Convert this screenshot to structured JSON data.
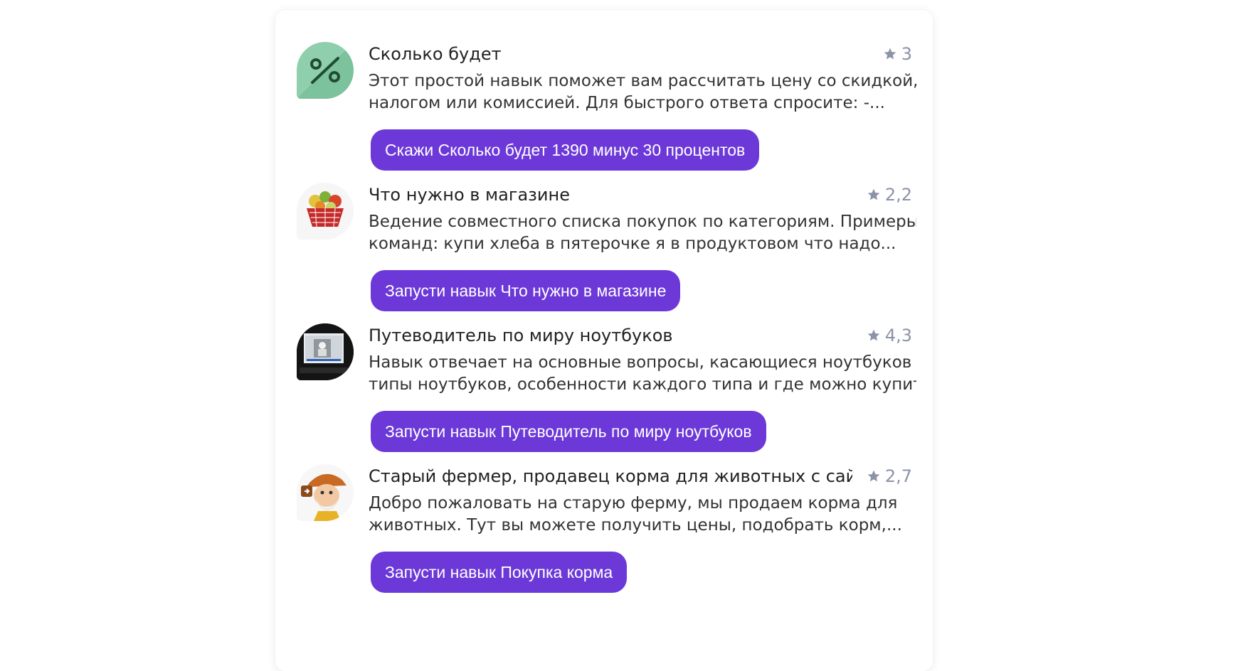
{
  "skills": [
    {
      "title": "Сколько будет",
      "rating": "3",
      "desc_line1": "Этот простой навык поможет вам рассчитать цену со скидкой,",
      "desc_line2": "налогом или комиссией. Для быстрого ответа спросите: -...",
      "button": "Скажи Сколько будет 1390 минус 30 процентов",
      "icon": "percent-icon"
    },
    {
      "title": "Что нужно в магазине",
      "rating": "2,2",
      "desc_line1": "Ведение совместного списка покупок по категориям. Примеры",
      "desc_line2": "команд: купи хлеба в пятерочке я в продуктовом что надо...",
      "button": "Запусти навык Что нужно в магазине",
      "icon": "grocery-basket-icon"
    },
    {
      "title": "Путеводитель по миру ноутбуков",
      "rating": "4,3",
      "desc_line1": "Навык отвечает на основные вопросы, касающиеся ноутбуков —",
      "desc_line2": "типы ноутбуков, особенности каждого типа и где можно купит...",
      "button": "Запусти навык Путеводитель по миру ноутбуков",
      "icon": "laptop-photo-icon"
    },
    {
      "title": "Старый фермер, продавец корма для животных с сайта...",
      "rating": "2,7",
      "desc_line1": "Добро пожаловать на старую ферму, мы продаем корма для",
      "desc_line2": "животных. Тут вы можете получить цены, подобрать корм,...",
      "button": "Запусти навык Покупка корма",
      "icon": "old-farmer-icon"
    }
  ],
  "colors": {
    "button_bg": "#6c39d8",
    "rating": "#8c93a8",
    "percent_icon_bg": "#8fcfad"
  }
}
